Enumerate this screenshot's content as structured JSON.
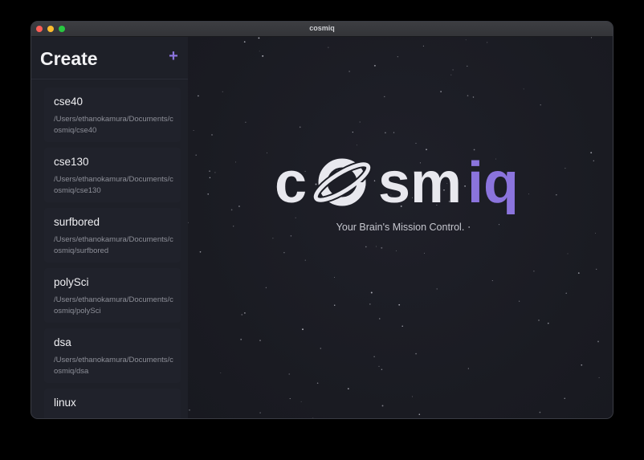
{
  "window": {
    "title": "cosmiq"
  },
  "sidebar": {
    "title": "Create",
    "add_label": "+",
    "items": [
      {
        "name": "cse40",
        "path": "/Users/ethanokamura/Documents/cosmiq/cse40"
      },
      {
        "name": "cse130",
        "path": "/Users/ethanokamura/Documents/cosmiq/cse130"
      },
      {
        "name": "surfbored",
        "path": "/Users/ethanokamura/Documents/cosmiq/surfbored"
      },
      {
        "name": "polySci",
        "path": "/Users/ethanokamura/Documents/cosmiq/polySci"
      },
      {
        "name": "dsa",
        "path": "/Users/ethanokamura/Documents/cosmiq/dsa"
      },
      {
        "name": "linux",
        "path": ""
      }
    ]
  },
  "main": {
    "logo": {
      "part1": "c",
      "part2": "sm",
      "part3": "iq",
      "icon": "planet-icon"
    },
    "tagline": "Your Brain's Mission Control."
  },
  "colors": {
    "accent": "#8b74dd",
    "logo_text": "#e8e8ee",
    "background": "#1b1d24"
  }
}
